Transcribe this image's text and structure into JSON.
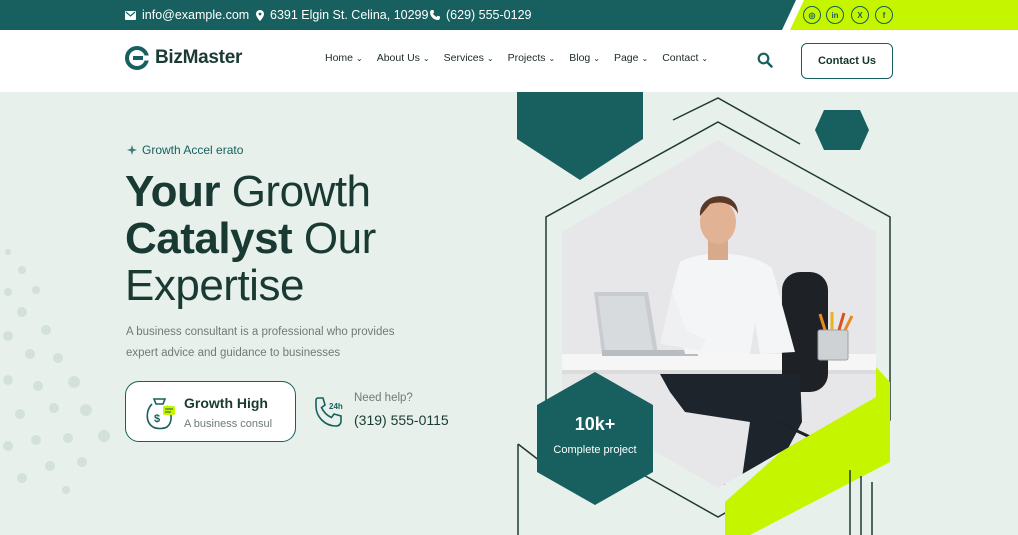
{
  "topbar": {
    "email": "info@example.com",
    "address": "6391 Elgin St. Celina, 10299",
    "phone": "(629) 555-0129",
    "social": [
      {
        "icon": "instagram-icon",
        "glyph": "◎"
      },
      {
        "icon": "linkedin-icon",
        "glyph": "in"
      },
      {
        "icon": "x-icon",
        "glyph": "X"
      },
      {
        "icon": "facebook-icon",
        "glyph": "f"
      }
    ]
  },
  "header": {
    "logo_text": "BizMaster",
    "nav": [
      "Home",
      "About Us",
      "Services",
      "Projects",
      "Blog",
      "Page",
      "Contact"
    ],
    "cta_label": "Contact Us"
  },
  "hero": {
    "eyebrow": "Growth Accel erato",
    "headline": {
      "line1_bold": "Your",
      "line1_light": "Growth",
      "line2_bold": "Catalyst",
      "line2_light": "Our",
      "line3_light": "Expertise"
    },
    "description": "A business consultant is a professional who provides expert advice and guidance to businesses",
    "card": {
      "title": "Growth High",
      "subtitle": "A business consul"
    },
    "help": {
      "label": "Need help?",
      "phone": "(319) 555-0115"
    },
    "stat": {
      "value": "10k+",
      "label": "Complete project"
    }
  },
  "colors": {
    "primary": "#17605f",
    "accent": "#c6f500",
    "background": "#e8f0ec",
    "text_dark": "#193a32"
  }
}
